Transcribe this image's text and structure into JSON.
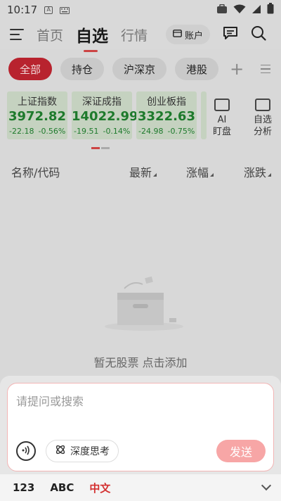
{
  "status_bar": {
    "time": "10:17"
  },
  "header": {
    "tabs": [
      {
        "label": "首页",
        "active": false
      },
      {
        "label": "自选",
        "active": true
      },
      {
        "label": "行情",
        "active": false
      }
    ],
    "account_label": "账户"
  },
  "filters": {
    "chips": [
      "全部",
      "持仓",
      "沪深京",
      "港股"
    ],
    "active_index": 0
  },
  "indices": [
    {
      "name": "上证指数",
      "value": "3972.82",
      "change": "-22.18",
      "pct": "-0.56%"
    },
    {
      "name": "深证成指",
      "value": "14022.99",
      "change": "-19.51",
      "pct": "-0.14%"
    },
    {
      "name": "创业板指",
      "value": "3322.63",
      "change": "-24.98",
      "pct": "-0.75%"
    }
  ],
  "tools": [
    {
      "line1": "AI",
      "line2": "盯盘"
    },
    {
      "line1": "自选",
      "line2": "分析"
    }
  ],
  "table": {
    "col_name": "名称/代码",
    "col_latest": "最新",
    "col_change_pct": "涨幅",
    "col_change": "涨跌"
  },
  "empty": {
    "text": "暂无股票  点击添加"
  },
  "ai_input": {
    "placeholder": "请提问或搜索",
    "think_label": "深度思考",
    "send_label": "发送"
  },
  "keyboard": {
    "num": "123",
    "abc": "ABC",
    "zh": "中文"
  },
  "colors": {
    "accent": "#b8232e",
    "down": "#1e7a2c",
    "send": "#f7a6a6"
  }
}
